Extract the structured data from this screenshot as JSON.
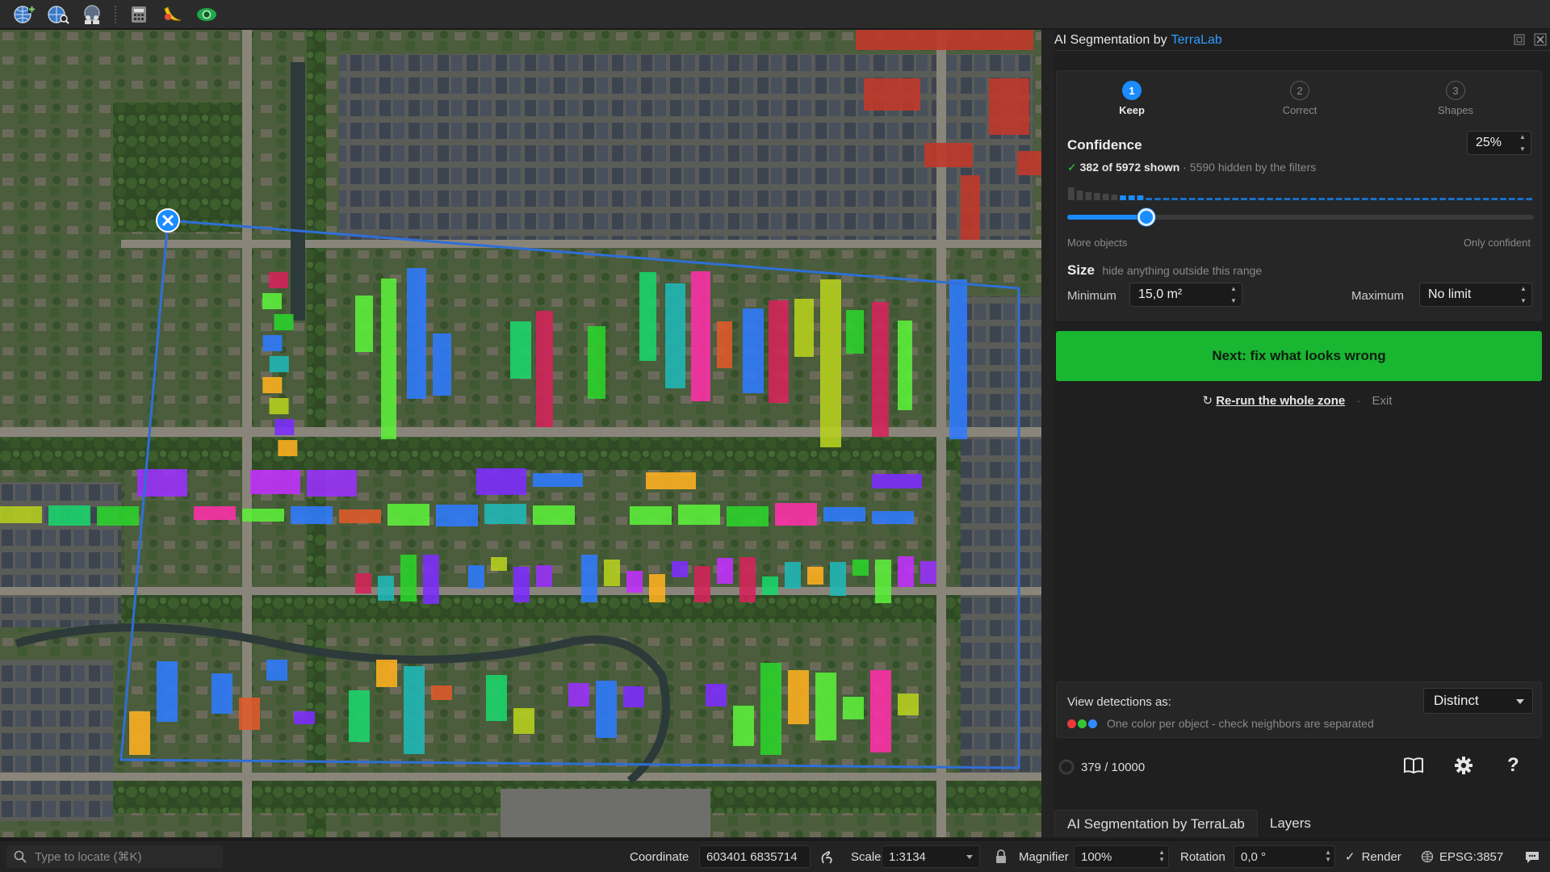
{
  "toolbar": {
    "icons": [
      "add-globe-layer-icon",
      "search-globe-icon",
      "people-globe-icon",
      "calculator-icon",
      "banana-icon",
      "eye-plugin-icon"
    ]
  },
  "panel": {
    "title": "AI Segmentation by",
    "brand": "TerraLab",
    "steps": [
      {
        "num": "1",
        "label": "Keep",
        "active": true
      },
      {
        "num": "2",
        "label": "Correct",
        "active": false
      },
      {
        "num": "3",
        "label": "Shapes",
        "active": false
      }
    ],
    "confidence": {
      "label": "Confidence",
      "value": "25%",
      "shown": "382 of 5972 shown",
      "hidden": "· 5590 hidden by the filters",
      "slider_fraction": 0.17,
      "left_label": "More objects",
      "right_label": "Only confident"
    },
    "size": {
      "label": "Size",
      "hint": "hide anything outside this range",
      "min_label": "Minimum",
      "min_value": "15,0 m²",
      "max_label": "Maximum",
      "max_value": "No limit"
    },
    "next_button": "Next: fix what looks wrong",
    "rerun": "Re-run the whole zone",
    "exit": "Exit",
    "view": {
      "label": "View detections as:",
      "value": "Distinct",
      "hint": "One color per object - check neighbors are separated",
      "swatch_colors": [
        "#e83a3a",
        "#36c23a",
        "#2f8bff"
      ]
    },
    "counter": "379 / 10000",
    "tabs": [
      "AI Segmentation by TerraLab",
      "Layers"
    ]
  },
  "statusbar": {
    "locate_placeholder": "Type to locate (⌘K)",
    "coordinate_label": "Coordinate",
    "coordinate_value": "603401  6835714",
    "scale_label": "Scale",
    "scale_value": "1:3134",
    "magnifier_label": "Magnifier",
    "magnifier_value": "100%",
    "rotation_label": "Rotation",
    "rotation_value": "0,0 °",
    "render_label": "Render",
    "crs": "EPSG:3857"
  },
  "colors": {
    "accent_blue": "#1a8cff",
    "next_green": "#19b632",
    "zone_outline": "#2f6fd6"
  }
}
